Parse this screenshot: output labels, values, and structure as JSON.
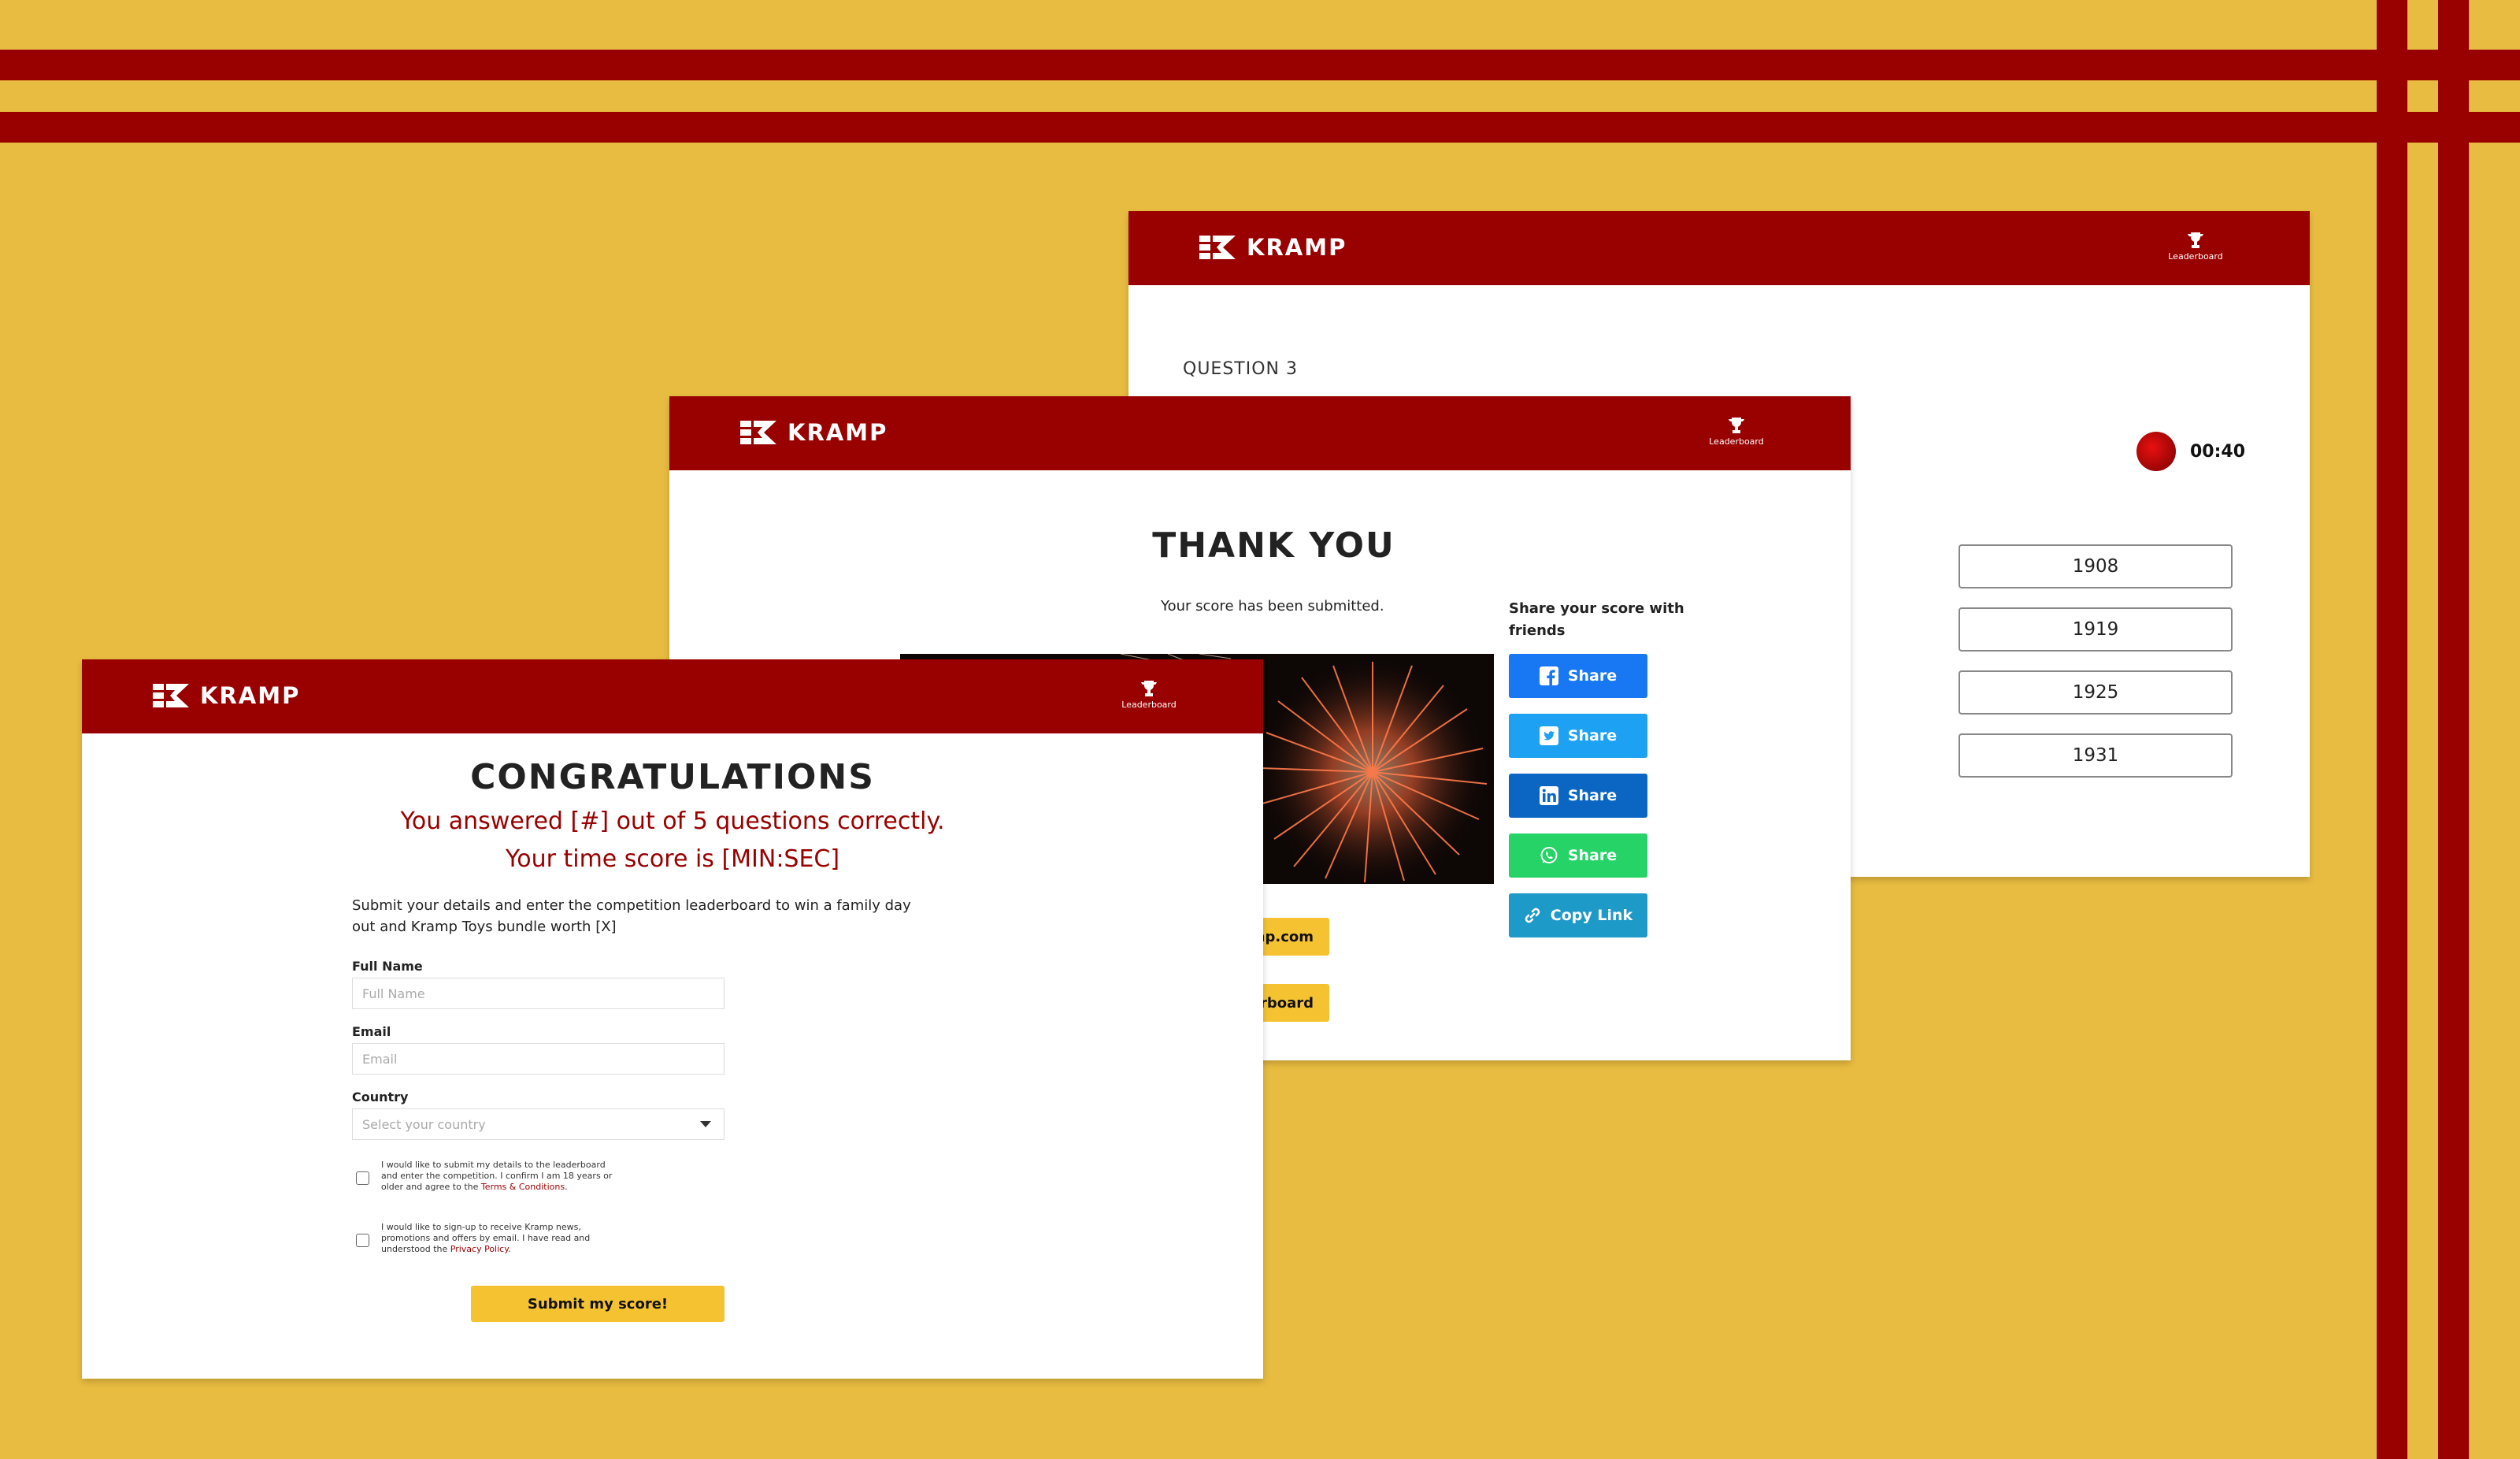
{
  "brand": {
    "name": "KRAMP",
    "primary": "#990000",
    "background": "#E8BC40",
    "button_yellow": "#F5C332"
  },
  "header": {
    "leaderboard_label": "Leaderboard",
    "leaderboard_icon": "trophy-icon"
  },
  "question": {
    "label": "QUESTION 3",
    "timer": "00:40",
    "answers": [
      "1908",
      "1919",
      "1925",
      "1931"
    ]
  },
  "thank_you": {
    "title": "THANK YOU",
    "subtitle": "Your score has been submitted.",
    "share_title_1": "Share your score with",
    "share_title_2": "friends",
    "share": {
      "facebook": "Share",
      "twitter": "Share",
      "linkedin": "Share",
      "whatsapp": "Share",
      "copy_link": "Copy Link"
    },
    "button_1_visible": "mp.com",
    "button_2_visible": "derboard"
  },
  "congrats": {
    "title": "CONGRATULATIONS",
    "line1": "You answered [#] out of 5 questions correctly.",
    "line2": "Your time score is [MIN:SEC]",
    "desc_line1": "Submit your details and enter the competition leaderboard to win a family day",
    "desc_line2": "out and Kramp Toys bundle worth [X]",
    "full_name_label": "Full Name",
    "full_name_placeholder": "Full Name",
    "email_label": "Email",
    "email_placeholder": "Email",
    "country_label": "Country",
    "country_placeholder": "Select your country",
    "consent1_line1": "I would like to submit my details to the leaderboard",
    "consent1_line2": "and enter the competition. I confirm I am 18 years or",
    "consent1_line3": "older and agree to the",
    "consent1_link": "Terms & Conditions",
    "consent2_line1": "I would like to sign-up to receive Kramp news,",
    "consent2_line2": "promotions and offers by email. I have read and",
    "consent2_line3": "understood the",
    "consent2_link": "Privacy Policy",
    "submit_label": "Submit my score!"
  }
}
